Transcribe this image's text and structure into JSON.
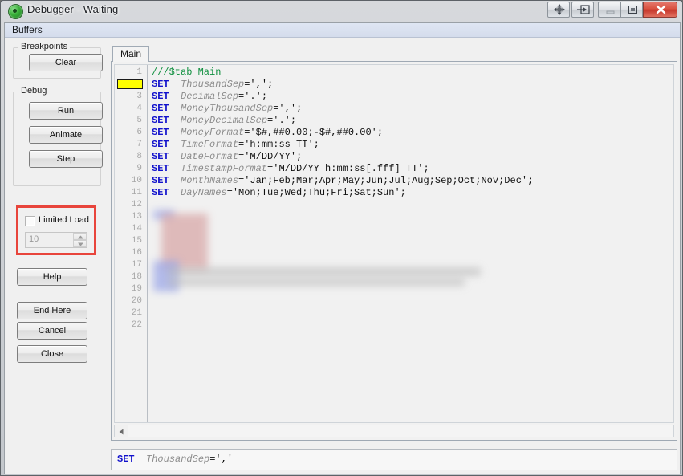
{
  "window": {
    "title": "Debugger - Waiting",
    "app_icon": "qlikview-green-circle-icon"
  },
  "titlebar_buttons": [
    {
      "name": "move-resize-button",
      "icon": "four-arrows-icon",
      "label": ""
    },
    {
      "name": "dock-button",
      "icon": "arrow-into-box-icon",
      "label": ""
    },
    {
      "name": "minimize-button",
      "icon": "minimize-icon",
      "label": ""
    },
    {
      "name": "maximize-button",
      "icon": "maximize-icon",
      "label": ""
    },
    {
      "name": "close-button",
      "icon": "close-x-icon",
      "label": ""
    }
  ],
  "menubar": {
    "items": [
      "Buffers"
    ],
    "buffers_label": "Buffers"
  },
  "sidebar": {
    "breakpoints": {
      "group_label": "Breakpoints",
      "clear_label": "Clear"
    },
    "debug": {
      "group_label": "Debug",
      "run_label": "Run",
      "animate_label": "Animate",
      "step_label": "Step"
    },
    "limited_load": {
      "checkbox_label": "Limited Load",
      "checked": false,
      "spinner_value": "10",
      "spinner_disabled": true,
      "highlight_color": "#e8453c"
    },
    "help_label": "Help",
    "end_here_label": "End Here",
    "cancel_label": "Cancel",
    "close_label": "Close"
  },
  "editor": {
    "tabs": [
      {
        "label": "Main",
        "active": true
      }
    ],
    "active_tab_label": "Main",
    "execution_line": 2,
    "total_lines": 22,
    "lines": [
      {
        "n": "1",
        "text": "///$tab Main",
        "type": "comment"
      },
      {
        "n": "2",
        "kw": "SET",
        "var": "ThousandSep",
        "rest": "=',';",
        "type": "code"
      },
      {
        "n": "3",
        "kw": "SET",
        "var": "DecimalSep",
        "rest": "='.';",
        "type": "code"
      },
      {
        "n": "4",
        "kw": "SET",
        "var": "MoneyThousandSep",
        "rest": "=',';",
        "type": "code"
      },
      {
        "n": "5",
        "kw": "SET",
        "var": "MoneyDecimalSep",
        "rest": "='.';",
        "type": "code"
      },
      {
        "n": "6",
        "kw": "SET",
        "var": "MoneyFormat",
        "rest": "='$#,##0.00;-$#,##0.00';",
        "type": "code"
      },
      {
        "n": "7",
        "kw": "SET",
        "var": "TimeFormat",
        "rest": "='h:mm:ss TT';",
        "type": "code"
      },
      {
        "n": "8",
        "kw": "SET",
        "var": "DateFormat",
        "rest": "='M/DD/YY';",
        "type": "code"
      },
      {
        "n": "9",
        "kw": "SET",
        "var": "TimestampFormat",
        "rest": "='M/DD/YY h:mm:ss[.fff] TT';",
        "type": "code"
      },
      {
        "n": "10",
        "kw": "SET",
        "var": "MonthNames",
        "rest": "='Jan;Feb;Mar;Apr;May;Jun;Jul;Aug;Sep;Oct;Nov;Dec';",
        "type": "code"
      },
      {
        "n": "11",
        "kw": "SET",
        "var": "DayNames",
        "rest": "='Mon;Tue;Wed;Thu;Fri;Sat;Sun';",
        "type": "code"
      },
      {
        "n": "12",
        "text": "",
        "type": "blank"
      },
      {
        "n": "13",
        "text": "",
        "type": "redacted"
      },
      {
        "n": "14",
        "text": "",
        "type": "redacted"
      },
      {
        "n": "15",
        "text": "",
        "type": "redacted"
      },
      {
        "n": "16",
        "text": "",
        "type": "redacted"
      },
      {
        "n": "17",
        "text": "",
        "type": "redacted"
      },
      {
        "n": "18",
        "text": "",
        "type": "redacted"
      },
      {
        "n": "19",
        "text": "",
        "type": "redacted"
      },
      {
        "n": "20",
        "text": "",
        "type": "redacted"
      },
      {
        "n": "21",
        "text": "",
        "type": "blank"
      },
      {
        "n": "22",
        "text": "",
        "type": "blank"
      }
    ],
    "scroll": {
      "horizontal_left_arrow": "triangle-left-icon"
    }
  },
  "status": {
    "kw": "SET",
    "var": "ThousandSep",
    "rest": "=','"
  },
  "colors": {
    "keyword": "#1111cc",
    "variable": "#8c8c8c",
    "comment": "#0f8f3f",
    "exec_marker": "#ffff00",
    "annotation": "#e8453c",
    "close_button": "#c5352a"
  }
}
